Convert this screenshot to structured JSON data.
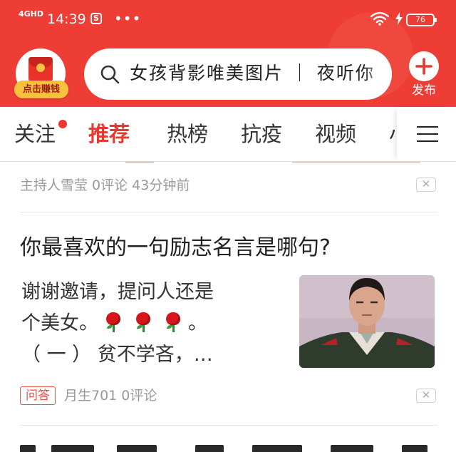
{
  "status_bar": {
    "network": "4GHD",
    "time": "14:39",
    "app_badge": "S",
    "more": "•••",
    "battery": "76",
    "icons": [
      "wifi-icon",
      "charging-icon",
      "battery-icon"
    ]
  },
  "header": {
    "earn_label": "点击赚钱",
    "search_text": "女孩背影唯美图片 ｜ 夜听你",
    "publish_label": "发布",
    "accent_color": "#ee3d34"
  },
  "tabs": {
    "items": [
      {
        "label": "关注",
        "has_dot": true
      },
      {
        "label": "推荐",
        "active": true
      },
      {
        "label": "热榜"
      },
      {
        "label": "抗疫"
      },
      {
        "label": "视频"
      }
    ],
    "partial_label": "小",
    "active_color": "#e63a30"
  },
  "feed": {
    "prev_item_meta": "主持人雪莹 0评论 43分钟前",
    "item": {
      "title": "你最喜欢的一句励志名言是哪句?",
      "snippet_line1": "谢谢邀请，提问人还是",
      "snippet_line2_before": "个美女。",
      "snippet_line2_after": "。",
      "snippet_line3": "（ 一 ）  贫不学吝，…",
      "tag": "问答",
      "meta": "月生701 0评论",
      "emoji": [
        "rose-icon",
        "rose-icon",
        "rose-icon"
      ]
    },
    "dismiss_symbol": "✕"
  }
}
